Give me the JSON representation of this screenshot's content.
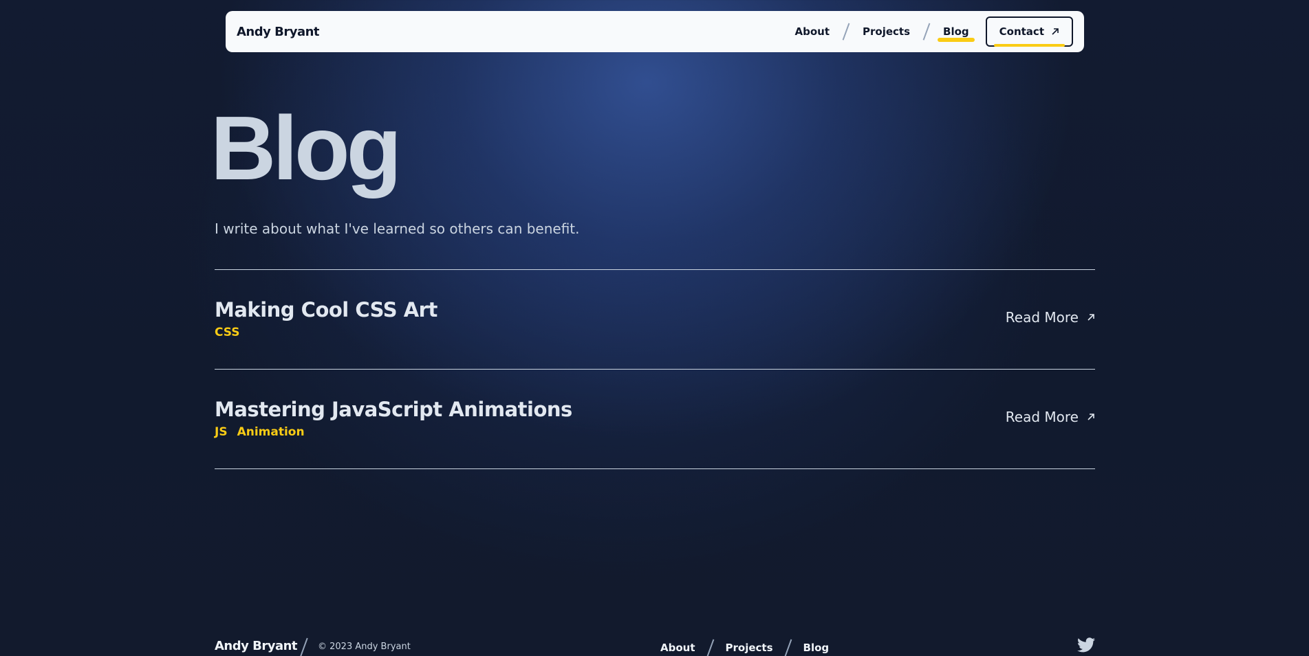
{
  "header": {
    "brand": "Andy Bryant",
    "nav": [
      {
        "label": "About"
      },
      {
        "label": "Projects"
      },
      {
        "label": "Blog"
      }
    ],
    "contact_label": "Contact"
  },
  "hero": {
    "title": "Blog",
    "subtitle": "I write about what I've learned so others can benefit."
  },
  "posts": [
    {
      "title": "Making Cool CSS Art",
      "tags": [
        "CSS"
      ],
      "read_more": "Read More"
    },
    {
      "title": "Mastering JavaScript Animations",
      "tags": [
        "JS",
        "Animation"
      ],
      "read_more": "Read More"
    }
  ],
  "footer": {
    "brand": "Andy Bryant",
    "copyright": "© 2023 Andy Bryant",
    "links": [
      {
        "label": "About"
      },
      {
        "label": "Projects"
      },
      {
        "label": "Blog"
      }
    ],
    "social_icon": "twitter-icon"
  },
  "colors": {
    "accent": "#facc15",
    "nav_bg": "#f8fafc",
    "page_bg": "#121b31"
  }
}
